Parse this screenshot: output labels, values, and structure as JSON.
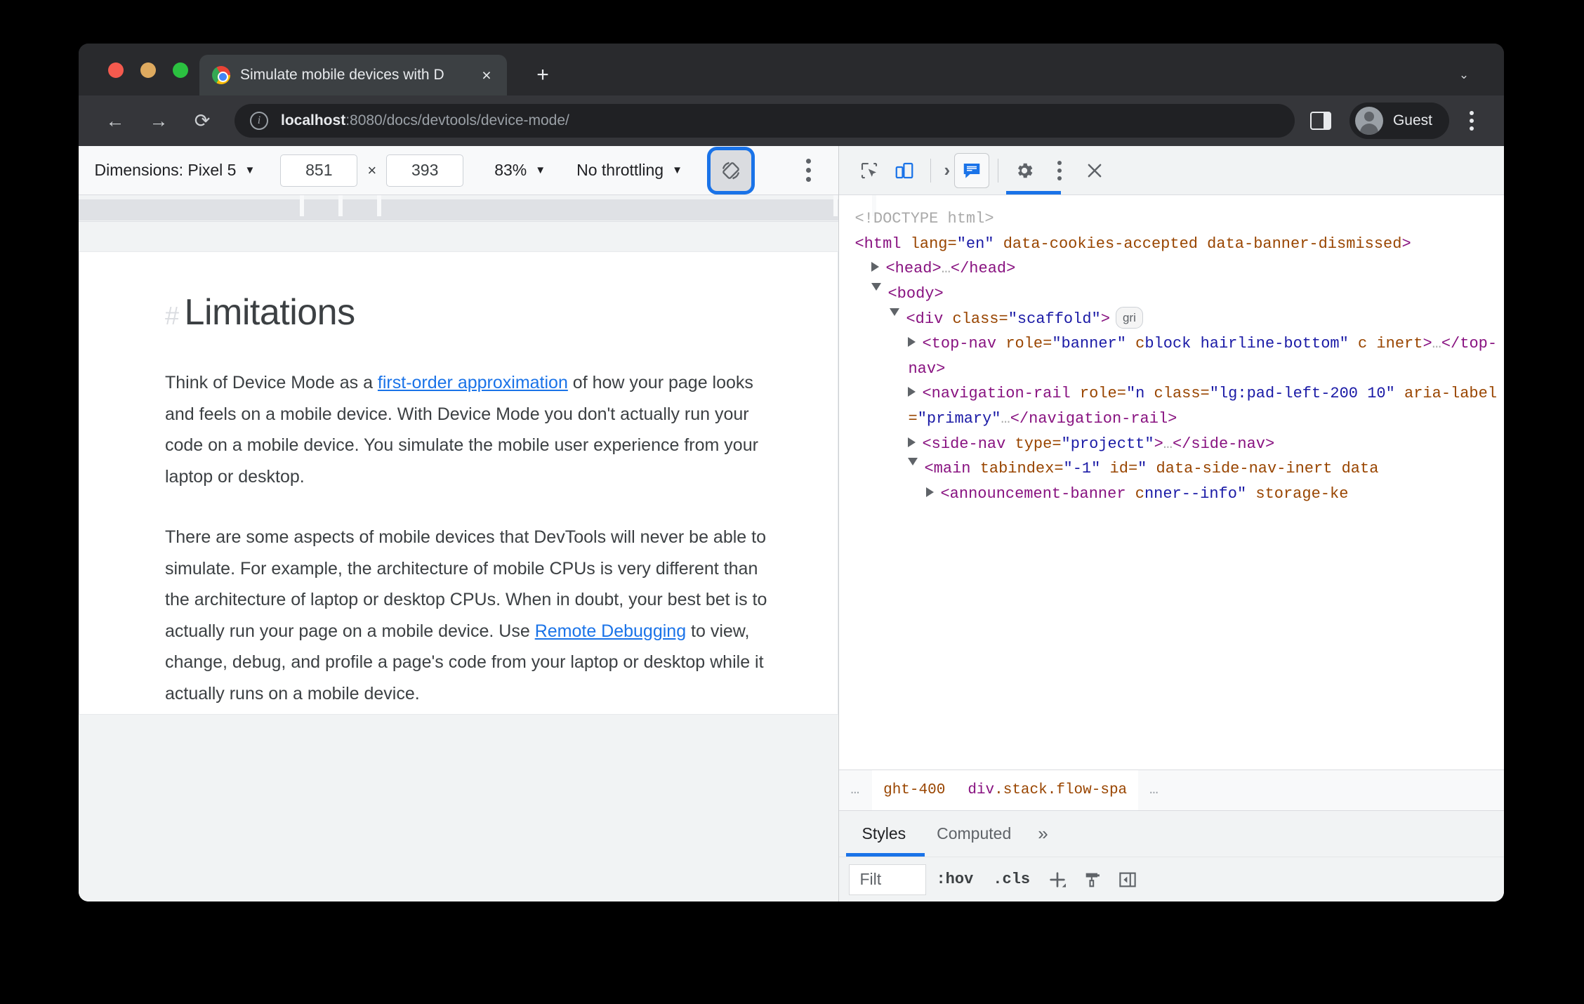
{
  "browser": {
    "tab": {
      "title": "Simulate mobile devices with D",
      "favicon": "chrome-icon",
      "close": "×"
    },
    "newtab_label": "+",
    "tabstrip_chevron": "⌄",
    "nav": {
      "back": "←",
      "forward": "→",
      "reload": "⟳"
    },
    "omnibox": {
      "info_icon": "i",
      "url_host": "localhost",
      "url_rest": ":8080/docs/devtools/device-mode/"
    },
    "profile": {
      "label": "Guest"
    }
  },
  "device_toolbar": {
    "dimensions_label": "Dimensions: Pixel 5",
    "width": "851",
    "height": "393",
    "times": "×",
    "zoom": "83%",
    "throttling": "No throttling",
    "caret": "▼",
    "rotate_icon": "rotate-icon",
    "more_icon": "kebab-icon"
  },
  "page": {
    "heading_hash": "#",
    "heading": "Limitations",
    "paragraph1_part1": "Think of Device Mode as a ",
    "paragraph1_link": "first-order approximation",
    "paragraph1_part2": " of how your page looks and feels on a mobile device. With Device Mode you don't actually run your code on a mobile device. You simulate the mobile user experience from your laptop or desktop.",
    "paragraph2_part1": "There are some aspects of mobile devices that DevTools will never be able to simulate. For example, the architecture of mobile CPUs is very different than the architecture of laptop or desktop CPUs. When in doubt, your best bet is to actually run your page on a mobile device. Use ",
    "paragraph2_link": "Remote Debugging",
    "paragraph2_part2": " to view, change, debug, and profile a page's code from your laptop or desktop while it actually runs on a mobile device."
  },
  "devtools": {
    "toolbar": {
      "inspect": "inspect-element-icon",
      "device": "device-toolbar-icon",
      "more_panels": "›",
      "console": "console-icon",
      "settings": "gear-icon",
      "more": "kebab-icon",
      "close": "×"
    },
    "dom": [
      {
        "indent": 0,
        "tri": "none",
        "parts": [
          {
            "c": "dc",
            "t": "<!DOCTYPE html>"
          }
        ]
      },
      {
        "indent": 0,
        "tri": "none",
        "parts": [
          {
            "c": "tg",
            "t": "<html "
          },
          {
            "c": "at",
            "t": "lang="
          },
          {
            "c": "av",
            "t": "\"en\""
          },
          {
            "c": "at",
            "t": " data-cookies-accepted data-banner-dismissed"
          },
          {
            "c": "tg",
            "t": ">"
          }
        ]
      },
      {
        "indent": 1,
        "tri": "closed",
        "parts": [
          {
            "c": "tg",
            "t": "<head>"
          },
          {
            "c": "dc",
            "t": "…"
          },
          {
            "c": "tg",
            "t": "</head>"
          }
        ]
      },
      {
        "indent": 1,
        "tri": "open",
        "parts": [
          {
            "c": "tg",
            "t": "<body>"
          }
        ]
      },
      {
        "indent": 2,
        "tri": "open",
        "badge": "gri",
        "parts": [
          {
            "c": "tg",
            "t": "<div "
          },
          {
            "c": "at",
            "t": "class="
          },
          {
            "c": "av",
            "t": "\"scaffold\""
          },
          {
            "c": "tg",
            "t": ">"
          }
        ]
      },
      {
        "indent": 3,
        "tri": "closed",
        "parts": [
          {
            "c": "tg",
            "t": "<top-nav "
          },
          {
            "c": "at",
            "t": "role="
          },
          {
            "c": "av",
            "t": "\"banner\""
          },
          {
            "c": "at",
            "t": " c"
          },
          {
            "c": "av",
            "t": "block hairline-bottom\""
          },
          {
            "c": "at",
            "t": " c"
          },
          {
            "c": "at",
            "t": " inert"
          },
          {
            "c": "tg",
            "t": ">"
          },
          {
            "c": "dc",
            "t": "…"
          },
          {
            "c": "tg",
            "t": "</top-nav>"
          }
        ]
      },
      {
        "indent": 3,
        "tri": "closed",
        "parts": [
          {
            "c": "tg",
            "t": "<navigation-rail "
          },
          {
            "c": "at",
            "t": "role="
          },
          {
            "c": "av",
            "t": "\"n"
          },
          {
            "c": "at",
            "t": " class="
          },
          {
            "c": "av",
            "t": "\"lg:pad-left-200 10\""
          },
          {
            "c": "at",
            "t": " aria-label="
          },
          {
            "c": "av",
            "t": "\"primary\""
          },
          {
            "c": "dc",
            "t": "…"
          },
          {
            "c": "tg",
            "t": "</navigation-rail>"
          }
        ]
      },
      {
        "indent": 3,
        "tri": "closed",
        "parts": [
          {
            "c": "tg",
            "t": "<side-nav "
          },
          {
            "c": "at",
            "t": "type="
          },
          {
            "c": "av",
            "t": "\"projectt\""
          },
          {
            "c": "tg",
            "t": ">"
          },
          {
            "c": "dc",
            "t": "…"
          },
          {
            "c": "tg",
            "t": "</side-nav>"
          }
        ]
      },
      {
        "indent": 3,
        "tri": "open",
        "parts": [
          {
            "c": "tg",
            "t": "<main "
          },
          {
            "c": "at",
            "t": "tabindex="
          },
          {
            "c": "av",
            "t": "\"-1\""
          },
          {
            "c": "at",
            "t": " id="
          },
          {
            "c": "av",
            "t": "\""
          },
          {
            "c": "at",
            "t": " data-side-nav-inert data"
          }
        ]
      },
      {
        "indent": 4,
        "tri": "closed",
        "parts": [
          {
            "c": "tg",
            "t": "<announcement-banner "
          },
          {
            "c": "at",
            "t": "c"
          },
          {
            "c": "av",
            "t": "nner--info\""
          },
          {
            "c": "at",
            "t": " storage-ke"
          }
        ]
      }
    ],
    "breadcrumb": {
      "left_ellipsis": "…",
      "item_truncated": "ght-400",
      "item_tag": "div",
      "item_classes": ".stack.flow-spa",
      "right_ellipsis": "…"
    },
    "panel_tabs": {
      "styles": "Styles",
      "computed": "Computed",
      "more": "»"
    },
    "styles_bar": {
      "filter_value": "Filt",
      "hov": ":hov",
      "cls": ".cls",
      "new_rule": "+",
      "paintbrush": "paintbrush-icon",
      "sidebar_toggle": "sidebar-toggle-icon"
    }
  }
}
